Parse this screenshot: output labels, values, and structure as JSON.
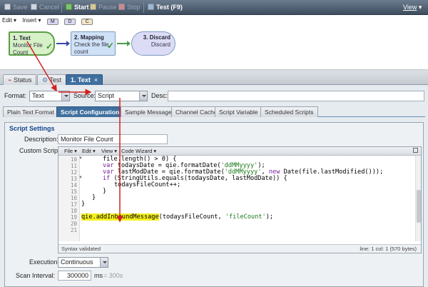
{
  "toolbar": {
    "save": "Save",
    "cancel": "Cancel",
    "start": "Start",
    "pause": "Pause",
    "stop": "Stop",
    "test": "Test (F9)",
    "view": "View",
    "view_arrow": "▾"
  },
  "canvas": {
    "menu_edit": "Edit ▾",
    "menu_insert": "Insert ▾",
    "chip_m": "M",
    "chip_d": "D",
    "chip_c": "C",
    "nodes": [
      {
        "title": "1. Text",
        "sub": "Monitor File Count"
      },
      {
        "title": "2. Mapping",
        "sub": "Check the file count"
      },
      {
        "title": "3. Discard",
        "sub": "Discard"
      }
    ]
  },
  "tabs": {
    "status": "Status",
    "test": "Test",
    "text": "1. Text",
    "close": "×"
  },
  "format_row": {
    "format_label": "Format:",
    "format_value": "Text",
    "source_label": "Source:",
    "source_value": "Script",
    "desc_label": "Desc:",
    "desc_value": ""
  },
  "subtabs": [
    "Plain Text Format",
    "Script Configuration",
    "Sample Messages",
    "Channel Cache",
    "Script Variable",
    "Scheduled Scripts"
  ],
  "settings": {
    "header": "Script Settings",
    "description_label": "Description:",
    "description_value": "Monitor File Count",
    "custom_script_label": "Custom Script:",
    "editor_menu": {
      "file": "File ▾",
      "edit": "Edit ▾",
      "view": "View ▾",
      "wizard": "Code Wizard ▾"
    },
    "line_numbers": [
      "10",
      "11",
      "12",
      "13",
      "14",
      "15",
      "16",
      "17",
      "18",
      "19",
      "20",
      "21"
    ],
    "code": {
      "l10a": "file.length() > 0) {",
      "l11kw": "var ",
      "l11a": "todaysDate = qie.formatDate(",
      "l11s": "'ddMMyyyy'",
      "l11b": ");",
      "l12kw": "var ",
      "l12a": "lastModDate = qie.formatDate(",
      "l12s": "'ddMMyyyy'",
      "l12b": ", ",
      "l12kw2": "new ",
      "l12c": "Date(file.lastModified()));",
      "l13kw": "if ",
      "l13a": "(StringUtils.equals(todaysDate, lastModDate)) {",
      "l14": "todaysFileCount++;",
      "l15": "}",
      "l16": "}",
      "l17": "}",
      "l19hl": "qie.addInboundMessage",
      "l19a": "(todaysFileCount, ",
      "l19s": "'fileCount'",
      "l19b": ");"
    },
    "status_left": "Syntax validated",
    "status_right": "line: 1  col: 1  (570 bytes)",
    "execution_label": "Execution:",
    "execution_value": "Continuous",
    "interval_label": "Scan Interval:",
    "interval_value": "300000",
    "interval_unit": "ms",
    "interval_hint": "= 300s"
  }
}
